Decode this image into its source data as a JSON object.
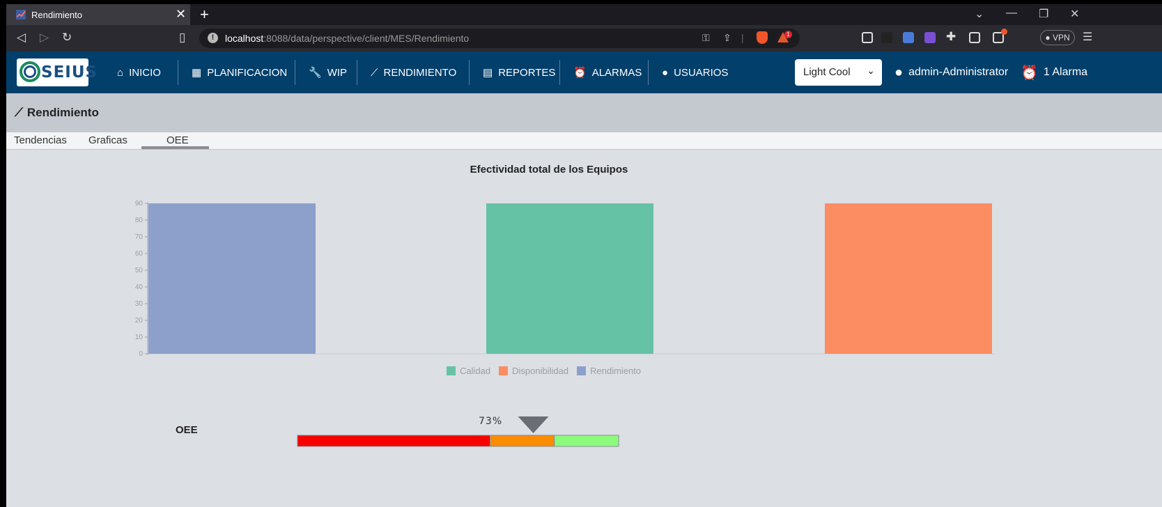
{
  "browser": {
    "tab_title": "Rendimiento",
    "url_host": "localhost",
    "url_rest": ":8088/data/perspective/client/MES/Rendimiento",
    "vpn_label": "VPN",
    "notif_count": "1"
  },
  "app": {
    "logo_text": "SEIUS",
    "nav": [
      {
        "label": "INICIO",
        "icon": "home-icon"
      },
      {
        "label": "PLANIFICACION",
        "icon": "calendar-icon"
      },
      {
        "label": "WIP",
        "icon": "wrench-icon"
      },
      {
        "label": "RENDIMIENTO",
        "icon": "trend-icon"
      },
      {
        "label": "REPORTES",
        "icon": "document-icon"
      },
      {
        "label": "ALARMAS",
        "icon": "alarm-clock-icon"
      },
      {
        "label": "USUARIOS",
        "icon": "person-icon"
      }
    ],
    "theme_value": "Light Cool",
    "user_label": "admin-Administrator",
    "alarm_label": "1 Alarma"
  },
  "page": {
    "title": "Rendimiento",
    "tabs": [
      "Tendencias",
      "Graficas",
      "OEE"
    ],
    "active_tab": "OEE"
  },
  "chart_data": {
    "type": "bar",
    "title": "Efectividad total de los Equipos",
    "ylim": [
      0,
      90
    ],
    "yticks": [
      "0",
      "10",
      "20",
      "30",
      "40",
      "50",
      "60",
      "70",
      "80",
      "90"
    ],
    "series": [
      {
        "name": "Rendimiento",
        "color": "#8ca0cb",
        "value": 90
      },
      {
        "name": "Calidad",
        "color": "#66c2a5",
        "value": 90
      },
      {
        "name": "Disponibilidad",
        "color": "#fc8d62",
        "value": 90
      }
    ],
    "legend": [
      "Calidad",
      "Disponibilidad",
      "Rendimiento"
    ],
    "legend_colors": [
      "#66c2a5",
      "#fc8d62",
      "#8ca0cb"
    ]
  },
  "gauge": {
    "label": "OEE",
    "value_text": "73%",
    "value": 73,
    "bands": [
      {
        "color": "#f60000",
        "to": 60
      },
      {
        "color": "#f98c00",
        "to": 80
      },
      {
        "color": "#8cfb7d",
        "to": 100
      }
    ]
  }
}
